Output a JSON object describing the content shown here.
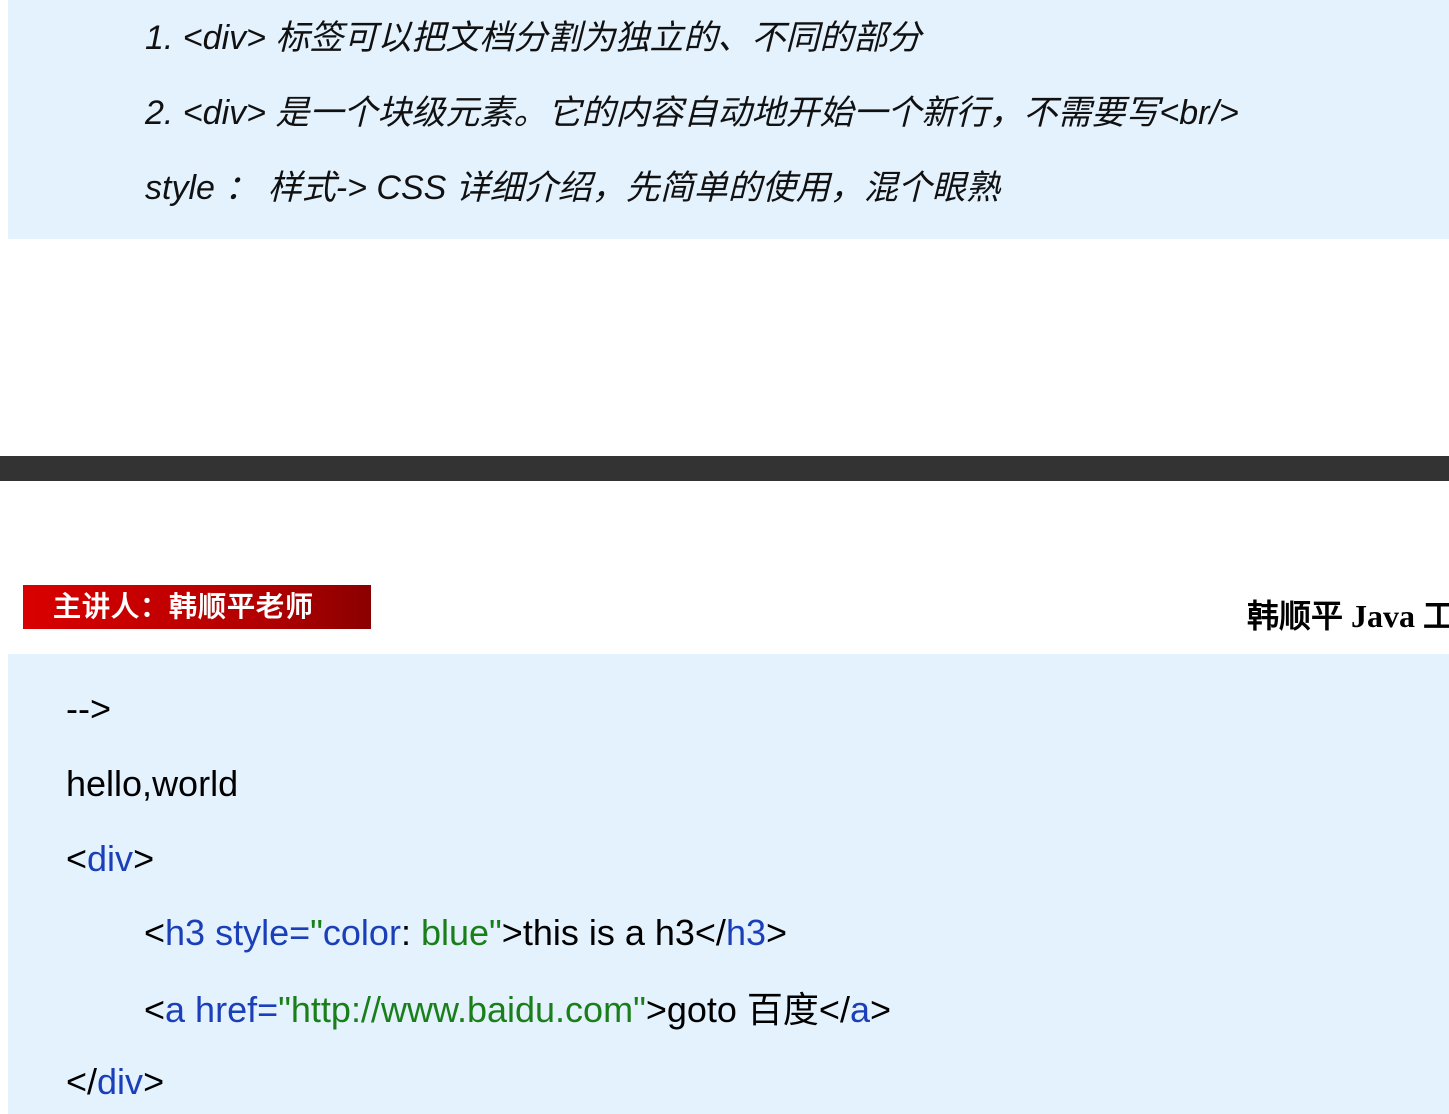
{
  "notes": {
    "line1": "1. <div>  标签可以把文档分割为独立的、不同的部分",
    "line2": "2. <div>  是一个块级元素。它的内容自动地开始一个新行，不需要写<br/>",
    "line3": "style  ：   样式-> CSS  详细介绍，先简单的使用，混个眼熟"
  },
  "banner": {
    "speaker": "主讲人：韩顺平老师",
    "header_right": "韩顺平 Java  工"
  },
  "code": {
    "comment_end": "-->",
    "hello": "hello,world",
    "div_open": {
      "lt": "<",
      "tag": "div",
      "gt": ">"
    },
    "h3_line": {
      "lt": "<",
      "tag_attr": "h3 style=",
      "quote_open": "\"",
      "attr_name": "color",
      "colon": ": ",
      "attr_val": "blue",
      "quote_close": "\"",
      "gt_text": ">this is a h3</",
      "close_tag": "h3",
      "end": ">"
    },
    "a_line": {
      "lt": "<",
      "tag_attr": "a href=",
      "url": "\"http://www.baidu.com\"",
      "gt_text": ">goto  百度</",
      "close_tag": "a",
      "end": ">"
    },
    "div_close": {
      "lt": "</",
      "tag": "div",
      "gt": ">"
    }
  },
  "colors": {
    "box_bg": "#e4f2fd",
    "divider": "#333333",
    "badge_red": "#d90000",
    "tag_blue": "#1a3fb8",
    "value_green": "#1a7f1a"
  }
}
